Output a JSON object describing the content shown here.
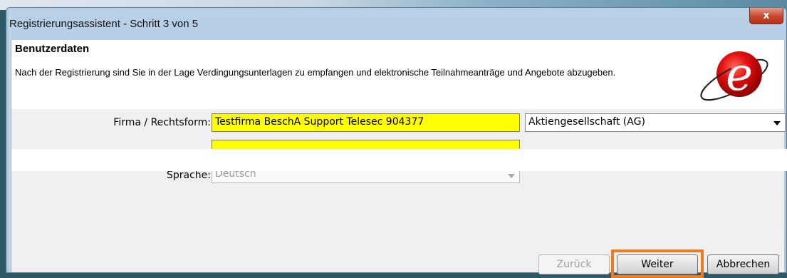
{
  "window": {
    "title": "Registrierungsassistent - Schritt 3 von 5",
    "close_label": "x"
  },
  "header": {
    "title": "Benutzerdaten",
    "description": "Nach der Registrierung sind Sie in der Lage Verdingungsunterlagen zu empfangen und elektronische Teilnahmeanträge und Angebote abzugeben.",
    "logo_letter": "e",
    "logo_color": "#d10000"
  },
  "form": {
    "firma_label": "Firma / Rechtsform:",
    "firma_value": "Testfirma BeschA Support Telesec 904377",
    "rechtsform_value": "Aktiengesellschaft (AG)",
    "sprache_label": "Sprache:",
    "sprache_value": "Deutsch",
    "field_highlight_color": "#ffff00"
  },
  "buttons": {
    "back": "Zurück",
    "next": "Weiter",
    "cancel": "Abbrechen"
  },
  "annotation": {
    "highlight_color": "#ee7a22"
  }
}
